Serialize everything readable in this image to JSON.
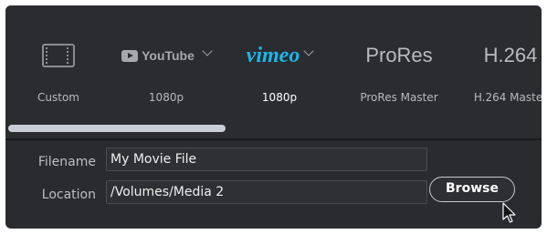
{
  "presets": [
    {
      "name": "custom",
      "logo_text": "",
      "label": "Custom",
      "selected": false
    },
    {
      "name": "youtube",
      "logo_text": "YouTube",
      "label": "1080p",
      "selected": false
    },
    {
      "name": "vimeo",
      "logo_text": "vimeo",
      "label": "1080p",
      "selected": true
    },
    {
      "name": "prores",
      "logo_text": "ProRes",
      "label": "ProRes Master",
      "selected": false
    },
    {
      "name": "h264",
      "logo_text": "H.264",
      "label": "H.264 Master",
      "selected": false
    }
  ],
  "fields": {
    "filename_label": "Filename",
    "filename_value": "My Movie File",
    "location_label": "Location",
    "location_value": "/Volumes/Media 2",
    "browse_label": "Browse"
  },
  "colors": {
    "panel": "#2a2b2f",
    "vimeo": "#1ab7ea",
    "scroll_thumb": "#c9cdd6"
  },
  "icons": [
    "film-icon",
    "youtube-play-icon",
    "chevron-down-icon",
    "mouse-cursor-icon"
  ]
}
